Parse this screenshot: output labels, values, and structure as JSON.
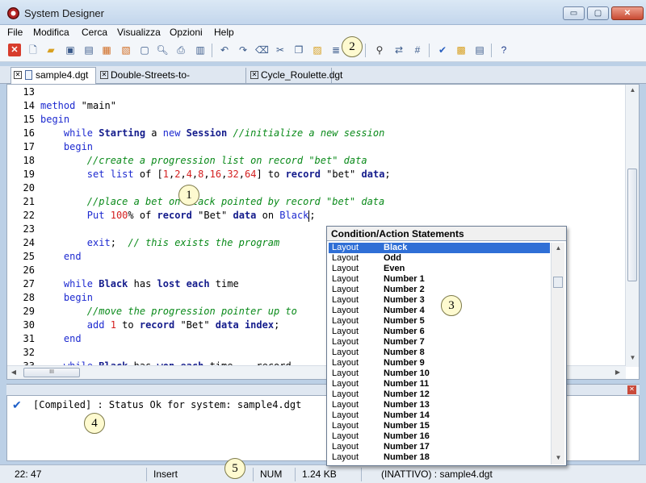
{
  "window": {
    "title": "System Designer",
    "minimize": "▭",
    "maximize": "▢",
    "close": "✕"
  },
  "menu": [
    "File",
    "Modifica",
    "Cerca",
    "Visualizza",
    "Opzioni",
    "Help"
  ],
  "toolbar": {
    "icons": [
      "exit-icon",
      "new-icon",
      "open-icon",
      "save-icon",
      "save-all-icon",
      "close-icon",
      "print-icon",
      "select-icon",
      "preview-icon",
      "printer-icon",
      "print-setup-icon",
      "undo-icon",
      "redo-icon",
      "erase-icon",
      "cut-icon",
      "copy-icon",
      "paste-icon",
      "indent-icon",
      "find-icon",
      "replace-icon",
      "goto-icon",
      "check-icon",
      "compile-icon",
      "doc-icon",
      "help-icon"
    ],
    "help_label": "?"
  },
  "tabs": [
    {
      "label": "sample4.dgt",
      "active": true
    },
    {
      "label": "Double-Streets-to-Winning.dgt",
      "active": false
    },
    {
      "label": "Cycle_Roulette.dgt",
      "active": false
    }
  ],
  "code": [
    {
      "n": "13",
      "parts": []
    },
    {
      "n": "14",
      "parts": [
        [
          "kw",
          "method"
        ],
        [
          "t",
          " \"main\""
        ]
      ]
    },
    {
      "n": "15",
      "parts": [
        [
          "kw",
          "begin"
        ]
      ]
    },
    {
      "n": "16",
      "parts": [
        [
          "t",
          "    "
        ],
        [
          "kw",
          "while"
        ],
        [
          "t",
          " "
        ],
        [
          "id",
          "Starting"
        ],
        [
          "t",
          " a "
        ],
        [
          "kw",
          "new"
        ],
        [
          "t",
          " "
        ],
        [
          "id",
          "Session"
        ],
        [
          "t",
          " "
        ],
        [
          "cm",
          "//initialize a new session"
        ]
      ]
    },
    {
      "n": "17",
      "parts": [
        [
          "t",
          "    "
        ],
        [
          "kw",
          "begin"
        ]
      ]
    },
    {
      "n": "18",
      "parts": [
        [
          "t",
          "        "
        ],
        [
          "cm",
          "//create a progression list on record \"bet\" data"
        ]
      ]
    },
    {
      "n": "19",
      "parts": [
        [
          "t",
          "        "
        ],
        [
          "kw",
          "set"
        ],
        [
          "t",
          " "
        ],
        [
          "kw",
          "list"
        ],
        [
          "t",
          " of ["
        ],
        [
          "num",
          "1"
        ],
        [
          "t",
          ","
        ],
        [
          "num",
          "2"
        ],
        [
          "t",
          ","
        ],
        [
          "num",
          "4"
        ],
        [
          "t",
          ","
        ],
        [
          "num",
          "8"
        ],
        [
          "t",
          ","
        ],
        [
          "num",
          "16"
        ],
        [
          "t",
          ","
        ],
        [
          "num",
          "32"
        ],
        [
          "t",
          ","
        ],
        [
          "num",
          "64"
        ],
        [
          "t",
          "] to "
        ],
        [
          "id",
          "record"
        ],
        [
          "t",
          " \"bet\" "
        ],
        [
          "id",
          "data"
        ],
        [
          "t",
          ";"
        ]
      ]
    },
    {
      "n": "20",
      "parts": []
    },
    {
      "n": "21",
      "parts": [
        [
          "t",
          "        "
        ],
        [
          "cm",
          "//place a bet on Black pointed by record \"bet\" data"
        ]
      ]
    },
    {
      "n": "22",
      "parts": [
        [
          "t",
          "        "
        ],
        [
          "kw",
          "Put"
        ],
        [
          "t",
          " "
        ],
        [
          "num",
          "100"
        ],
        [
          "t",
          "% of "
        ],
        [
          "id",
          "record"
        ],
        [
          "t",
          " \"Bet\" "
        ],
        [
          "id",
          "data"
        ],
        [
          "t",
          " on "
        ],
        [
          "kw",
          "Black"
        ],
        [
          "caret",
          ""
        ],
        [
          "t",
          ";"
        ]
      ]
    },
    {
      "n": "23",
      "parts": []
    },
    {
      "n": "24",
      "parts": [
        [
          "t",
          "        "
        ],
        [
          "kw",
          "exit"
        ],
        [
          "t",
          ";  "
        ],
        [
          "cm",
          "// this exists the program"
        ]
      ]
    },
    {
      "n": "25",
      "parts": [
        [
          "t",
          "    "
        ],
        [
          "kw",
          "end"
        ]
      ]
    },
    {
      "n": "26",
      "parts": []
    },
    {
      "n": "27",
      "parts": [
        [
          "t",
          "    "
        ],
        [
          "kw",
          "while"
        ],
        [
          "t",
          " "
        ],
        [
          "id",
          "Black"
        ],
        [
          "t",
          " has "
        ],
        [
          "id",
          "lost"
        ],
        [
          "t",
          " "
        ],
        [
          "id",
          "each"
        ],
        [
          "t",
          " time"
        ]
      ]
    },
    {
      "n": "28",
      "parts": [
        [
          "t",
          "    "
        ],
        [
          "kw",
          "begin"
        ]
      ]
    },
    {
      "n": "29",
      "parts": [
        [
          "t",
          "        "
        ],
        [
          "cm",
          "//move the progression pointer up to"
        ]
      ]
    },
    {
      "n": "30",
      "parts": [
        [
          "t",
          "        "
        ],
        [
          "kw",
          "add"
        ],
        [
          "t",
          " "
        ],
        [
          "num",
          "1"
        ],
        [
          "t",
          " to "
        ],
        [
          "id",
          "record"
        ],
        [
          "t",
          " \"Bet\" "
        ],
        [
          "id",
          "data"
        ],
        [
          "t",
          " "
        ],
        [
          "id",
          "index"
        ],
        [
          "t",
          ";"
        ]
      ]
    },
    {
      "n": "31",
      "parts": [
        [
          "t",
          "    "
        ],
        [
          "kw",
          "end"
        ]
      ]
    },
    {
      "n": "32",
      "parts": []
    },
    {
      "n": "33",
      "parts": [
        [
          "t",
          "    "
        ],
        [
          "kw",
          "while"
        ],
        [
          "t",
          " "
        ],
        [
          "id",
          "Black"
        ],
        [
          "t",
          " has "
        ],
        [
          "id",
          "won"
        ],
        [
          "t",
          " "
        ],
        [
          "id",
          "each"
        ],
        [
          "t",
          " time    record"
        ]
      ]
    }
  ],
  "popup": {
    "title": "Condition/Action Statements",
    "items": [
      [
        "Layout",
        "Black"
      ],
      [
        "Layout",
        "Odd"
      ],
      [
        "Layout",
        "Even"
      ],
      [
        "Layout",
        "Number 1"
      ],
      [
        "Layout",
        "Number 2"
      ],
      [
        "Layout",
        "Number 3"
      ],
      [
        "Layout",
        "Number 4"
      ],
      [
        "Layout",
        "Number 5"
      ],
      [
        "Layout",
        "Number 6"
      ],
      [
        "Layout",
        "Number 7"
      ],
      [
        "Layout",
        "Number 8"
      ],
      [
        "Layout",
        "Number 9"
      ],
      [
        "Layout",
        "Number 10"
      ],
      [
        "Layout",
        "Number 11"
      ],
      [
        "Layout",
        "Number 12"
      ],
      [
        "Layout",
        "Number 13"
      ],
      [
        "Layout",
        "Number 14"
      ],
      [
        "Layout",
        "Number 15"
      ],
      [
        "Layout",
        "Number 16"
      ],
      [
        "Layout",
        "Number 17"
      ],
      [
        "Layout",
        "Number 18"
      ]
    ]
  },
  "output": {
    "message": "[Compiled] : Status Ok for system: sample4.dgt"
  },
  "status": {
    "position": "22: 47",
    "mode": "Insert",
    "num": "NUM",
    "size": "1.24 KB",
    "state": "(INATTIVO) : sample4.dgt"
  },
  "callouts": [
    "1",
    "2",
    "3",
    "4",
    "5"
  ],
  "hscroll_thumb": "III"
}
